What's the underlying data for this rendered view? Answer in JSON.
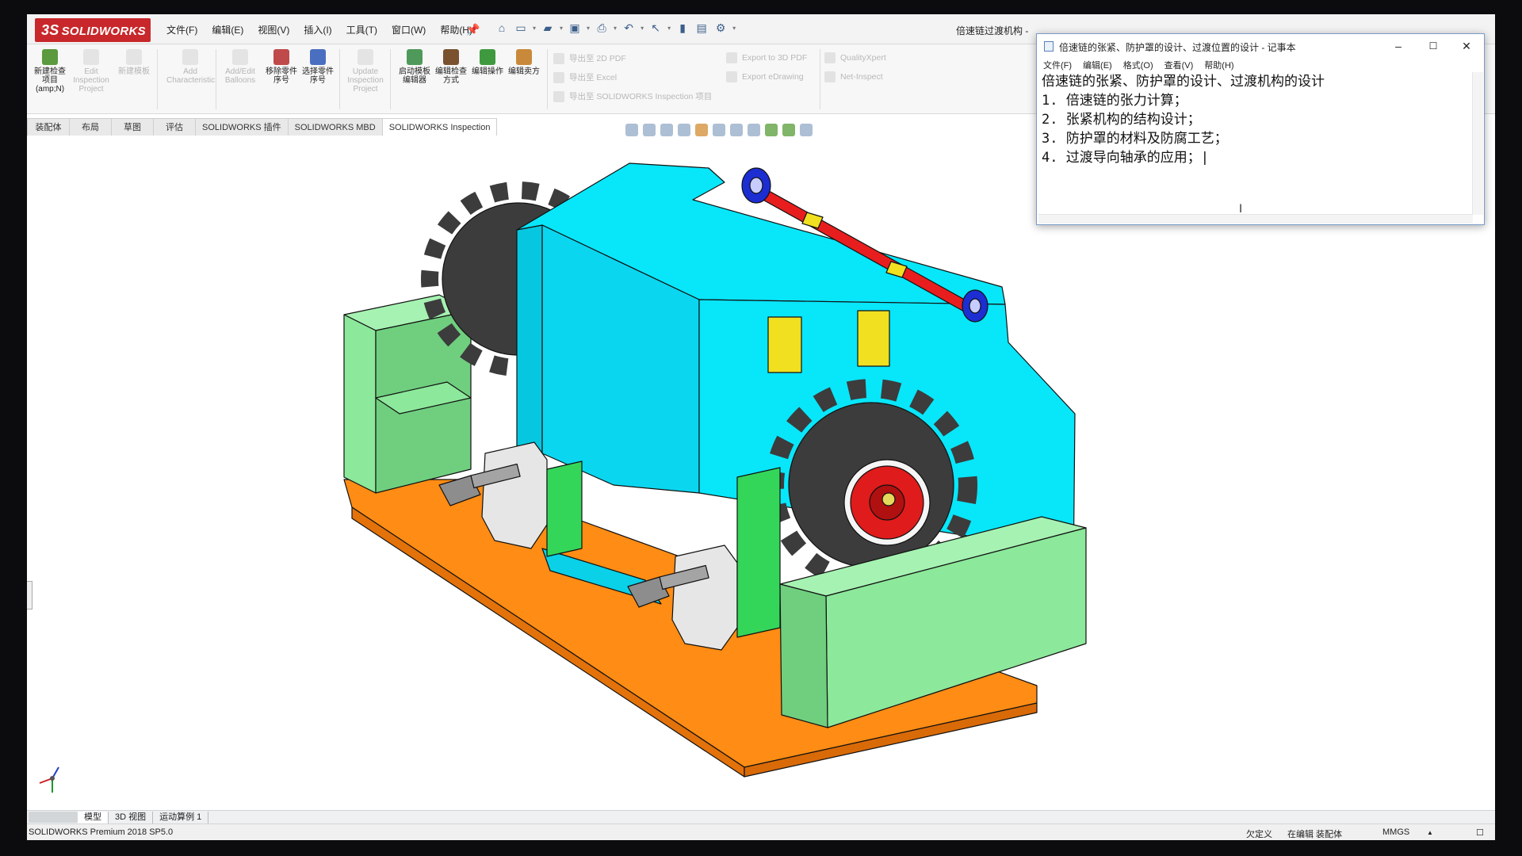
{
  "app": {
    "logo_text": "SOLIDWORKS",
    "logo_mark": "3S",
    "document_title": "倍速链过渡机构 -"
  },
  "menu": {
    "items": [
      "文件(F)",
      "编辑(E)",
      "视图(V)",
      "插入(I)",
      "工具(T)",
      "窗口(W)",
      "帮助(H)"
    ]
  },
  "ribbon": {
    "buttons": [
      {
        "label": "新建检查项目(amp;N)",
        "enabled": true
      },
      {
        "label": "Edit Inspection Project",
        "enabled": false
      },
      {
        "label": "新建模板",
        "enabled": false
      },
      {
        "label": "Add Characteristic",
        "enabled": false
      },
      {
        "label": "Add/Edit Balloons",
        "enabled": false
      },
      {
        "label": "移除零件序号",
        "enabled": true
      },
      {
        "label": "选择零件序号",
        "enabled": true
      },
      {
        "label": "Update Inspection Project",
        "enabled": false
      },
      {
        "label": "启动模板编辑器",
        "enabled": true
      },
      {
        "label": "编辑检查方式",
        "enabled": true
      },
      {
        "label": "编辑操作",
        "enabled": true
      },
      {
        "label": "编辑卖方",
        "enabled": true
      }
    ],
    "export_items": [
      "导出至 2D PDF",
      "导出至 Excel",
      "导出至 SOLIDWORKS Inspection 项目",
      "Export to 3D PDF",
      "Export eDrawing",
      "QualityXpert",
      "Net-Inspect"
    ]
  },
  "tabs": {
    "items": [
      "装配体",
      "布局",
      "草图",
      "评估",
      "SOLIDWORKS 插件",
      "SOLIDWORKS MBD",
      "SOLIDWORKS Inspection"
    ],
    "active": "SOLIDWORKS Inspection"
  },
  "bottom_tabs": {
    "items": [
      "模型",
      "3D 视图",
      "运动算例 1"
    ],
    "active": "模型"
  },
  "status": {
    "product": "SOLIDWORKS Premium 2018 SP5.0",
    "definition": "欠定义",
    "editing": "在编辑 装配体",
    "units": "MMGS",
    "units_arrow": "▲"
  },
  "notepad": {
    "title": "倍速链的张紧、防护罩的设计、过渡位置的设计 - 记事本",
    "menu": [
      "文件(F)",
      "编辑(E)",
      "格式(O)",
      "查看(V)",
      "帮助(H)"
    ],
    "lines": [
      "倍速链的张紧、防护罩的设计、过渡机构的设计",
      "1. 倍速链的张力计算；",
      "2. 张紧机构的结构设计；",
      "3. 防护罩的材料及防腐工艺；",
      "4. 过渡导向轴承的应用；|"
    ],
    "window_controls": [
      "–",
      "☐",
      "✕"
    ]
  },
  "colors": {
    "brand_red": "#c8282b",
    "cover_cyan": "#08e6fa",
    "frame_green": "#8ce89a",
    "base_orange": "#ff8c14",
    "sprocket_dark": "#3c3c3c",
    "shaft_red": "#e81e1e",
    "bearing_blue": "#1c2ed2",
    "spacer_yellow": "#f0e020"
  },
  "icons": {
    "triad": "xyz-triad-icon",
    "notepad_app": "notepad-icon",
    "pin": "pin-icon"
  }
}
